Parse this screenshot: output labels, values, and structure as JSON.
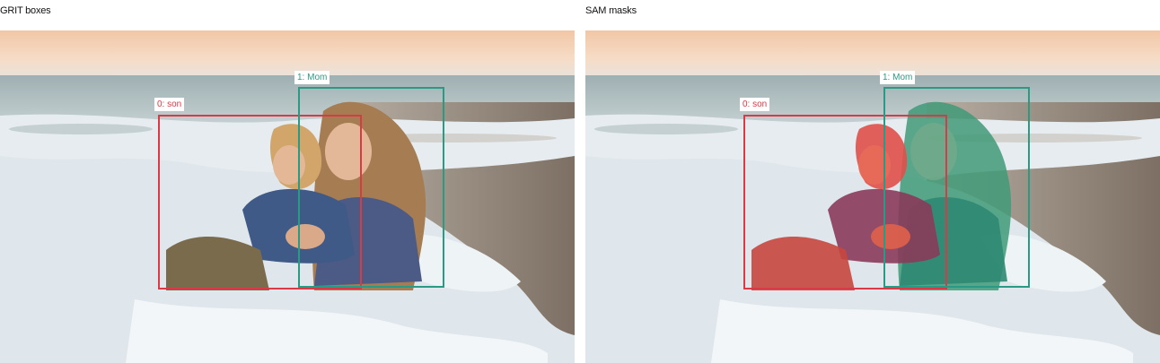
{
  "panels": {
    "left": {
      "title": "GRIT boxes"
    },
    "right": {
      "title": "SAM masks"
    }
  },
  "detections": [
    {
      "label": "0: son",
      "color": "#d93a45"
    },
    {
      "label": "1: Mom",
      "color": "#2a9a85"
    }
  ],
  "mask_colors": {
    "son": "#e0504a",
    "mom": "#3f9a78"
  }
}
